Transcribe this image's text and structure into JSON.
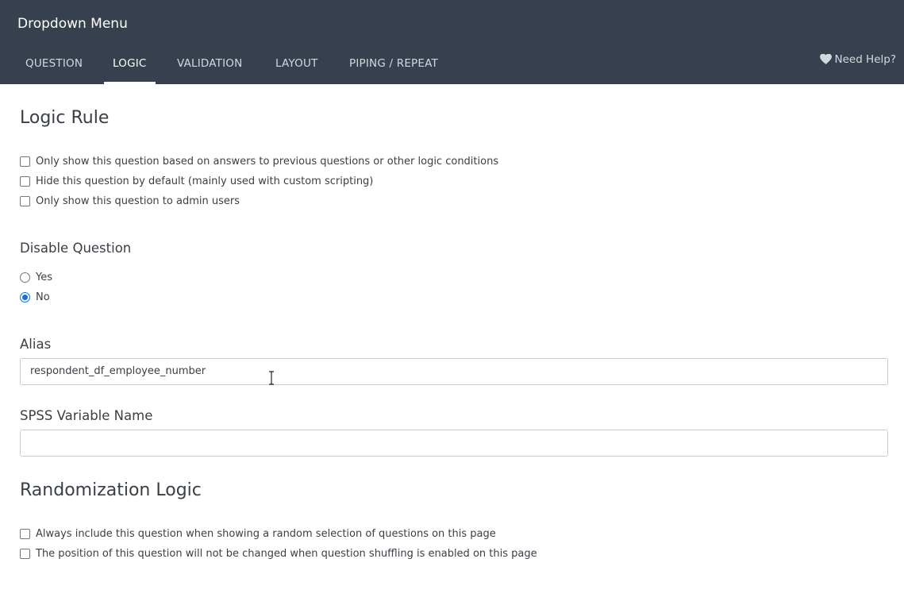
{
  "header": {
    "title": "Dropdown Menu",
    "tabs": [
      {
        "label": "QUESTION",
        "active": false
      },
      {
        "label": "LOGIC",
        "active": true
      },
      {
        "label": "VALIDATION",
        "active": false
      },
      {
        "label": "LAYOUT",
        "active": false
      },
      {
        "label": "PIPING / REPEAT",
        "active": false
      }
    ],
    "help_label": "Need Help?",
    "help_icon": "heart-icon"
  },
  "logic_rule": {
    "title": "Logic Rule",
    "options": [
      {
        "label": "Only show this question based on answers to previous questions or other logic conditions",
        "checked": false
      },
      {
        "label": "Hide this question by default (mainly used with custom scripting)",
        "checked": false
      },
      {
        "label": "Only show this question to admin users",
        "checked": false
      }
    ]
  },
  "disable_question": {
    "title": "Disable Question",
    "options": [
      {
        "label": "Yes",
        "selected": false
      },
      {
        "label": "No",
        "selected": true
      }
    ]
  },
  "alias": {
    "label": "Alias",
    "value": "respondent_df_employee_number"
  },
  "spss": {
    "label": "SPSS Variable Name",
    "value": ""
  },
  "randomization": {
    "title": "Randomization Logic",
    "options": [
      {
        "label": "Always include this question when showing a random selection of questions on this page",
        "checked": false
      },
      {
        "label": "The position of this question will not be changed when question shuffling is enabled on this page",
        "checked": false
      }
    ]
  },
  "colors": {
    "header_bg": "#36404e",
    "accent": "#0b72e7"
  }
}
